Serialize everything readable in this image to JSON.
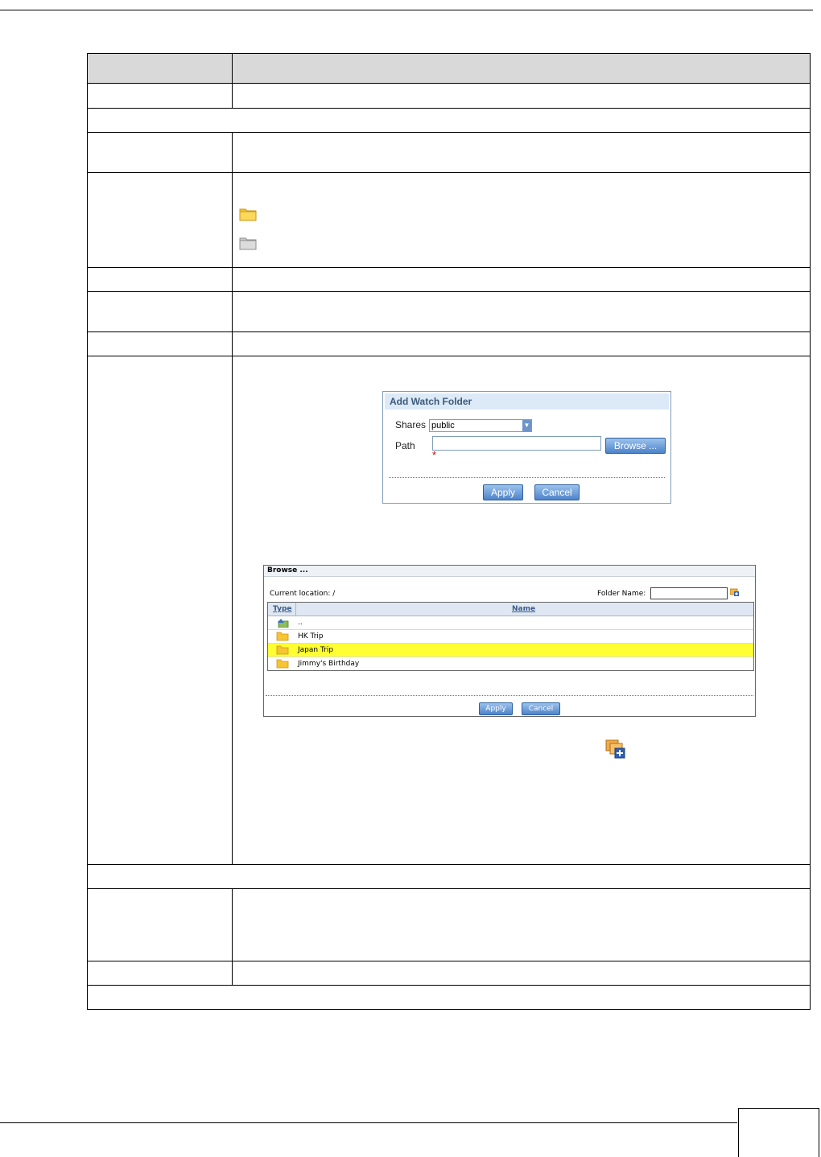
{
  "add_watch_folder": {
    "title": "Add Watch Folder",
    "shares_label": "Shares",
    "shares_value": "public",
    "path_label": "Path",
    "path_value": "",
    "required_mark": "*",
    "browse_label": "Browse ...",
    "apply_label": "Apply",
    "cancel_label": "Cancel"
  },
  "browse_dialog": {
    "title": "Browse ...",
    "current_location": "Current location: /",
    "folder_name_label": "Folder Name:",
    "folder_name_value": "",
    "col_type": "Type",
    "col_name": "Name",
    "rows": [
      {
        "name": "..",
        "icon": "parent-folder-icon",
        "selected": false
      },
      {
        "name": "HK Trip",
        "icon": "folder-icon",
        "selected": false
      },
      {
        "name": "Japan Trip",
        "icon": "folder-icon",
        "selected": true
      },
      {
        "name": "Jimmy's Birthday",
        "icon": "folder-icon",
        "selected": false
      }
    ],
    "apply_label": "Apply",
    "cancel_label": "Cancel"
  },
  "colors": {
    "highlight": "#ffff33",
    "header_fill": "#d9d9d9",
    "dialog_title_bg": "#dce9f6",
    "button_blue": "#4d83c9"
  }
}
